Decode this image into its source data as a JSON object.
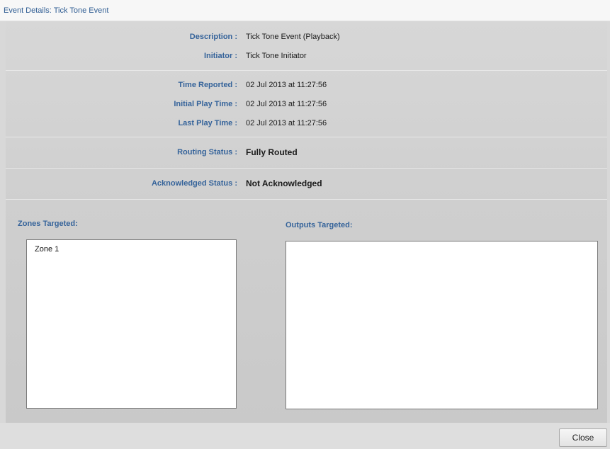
{
  "window": {
    "title": "Event Details: Tick Tone Event"
  },
  "details": {
    "description_label": "Description :",
    "description_value": "Tick Tone Event (Playback)",
    "initiator_label": "Initiator :",
    "initiator_value": "Tick Tone Initiator",
    "time_reported_label": "Time Reported :",
    "time_reported_value": "02 Jul 2013 at 11:27:56",
    "initial_play_label": "Initial Play Time :",
    "initial_play_value": "02 Jul 2013 at 11:27:56",
    "last_play_label": "Last Play Time :",
    "last_play_value": "02 Jul 2013 at 11:27:56",
    "routing_label": "Routing Status :",
    "routing_value": "Fully Routed",
    "ack_label": "Acknowledged Status :",
    "ack_value": "Not Acknowledged"
  },
  "zones": {
    "label": "Zones Targeted:",
    "items": [
      "Zone 1"
    ]
  },
  "outputs": {
    "label": "Outputs Targeted:",
    "items": []
  },
  "footer": {
    "close_label": "Close"
  }
}
